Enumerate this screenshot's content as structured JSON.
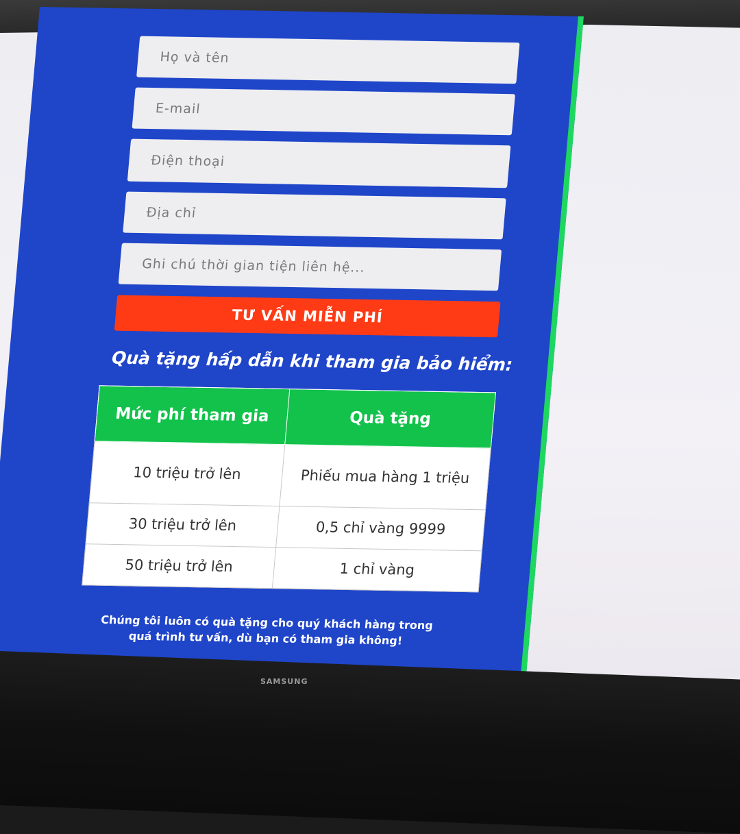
{
  "form": {
    "name_placeholder": "Họ và tên",
    "email_placeholder": "E-mail",
    "phone_placeholder": "Điện thoại",
    "address_placeholder": "Địa chỉ",
    "note_placeholder": "Ghi chú thời gian tiện liên hệ...",
    "submit_label": "TƯ VẤN MIỄN PHÍ"
  },
  "gifts": {
    "heading": "Quà tặng hấp dẫn khi tham gia bảo hiểm:",
    "columns": [
      "Mức phí tham gia",
      "Quà tặng"
    ],
    "rows": [
      [
        "10 triệu trở lên",
        "Phiếu mua hàng 1 triệu"
      ],
      [
        "30 triệu trở lên",
        "0,5 chỉ vàng 9999"
      ],
      [
        "50 triệu trở lên",
        "1 chỉ vàng"
      ]
    ],
    "footnote_line1": "Chúng tôi luôn có quà tặng cho quý khách hàng trong",
    "footnote_line2": "quá trình tư vấn, dù bạn có tham gia không!"
  },
  "monitor": {
    "brand": "SAMSUNG"
  },
  "colors": {
    "panel_blue": "#1f45c9",
    "accent_green": "#1ed760",
    "button_red": "#ff3b16",
    "table_header_green": "#12c24b"
  }
}
